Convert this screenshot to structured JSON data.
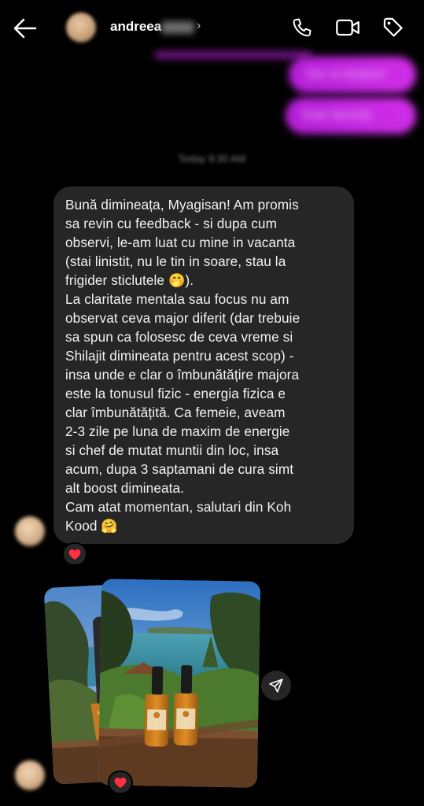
{
  "header": {
    "back_icon": "arrow-left-icon",
    "name": "andreea",
    "chevron": "›",
    "icons": [
      "phone-icon",
      "video-camera-icon",
      "tag-icon"
    ]
  },
  "outgoing": [
    {
      "text": "Dar ai drepturi"
    },
    {
      "text": "Este favorite"
    }
  ],
  "timestamp": "Today 9:30 AM",
  "incoming_message": {
    "text": "Bună dimineața, Myagisan! Am promis\nsa revin cu feedback - si dupa cum\nobservi, le-am luat cu mine in vacanta\n(stai linistit, nu le tin in soare, stau la\nfrigider sticlutele 🤭).\nLa claritate mentala sau focus nu am\nobservat ceva major diferit (dar trebuie\nsa spun ca folosesc de ceva vreme si\nShilajit dimineata pentru acest scop) -\ninsa unde e clar o îmbunătățire majora\neste la tonusul fizic - energia fizica e\nclar îmbunătățită. Ca femeie, aveam\n2-3 zile pe luna de maxim de energie\nsi chef de mutat muntii din loc, insa\nacum, dupa 3 saptamani de cura simt\nalt boost dimineata.\nCam atat momentan, salutari din Koh\nKood 🤗",
    "reaction": "heart-icon"
  },
  "photo_message": {
    "reaction": "heart-icon",
    "share_icon": "send-icon"
  },
  "colors": {
    "background": "#000000",
    "incoming_bubble": "#262626",
    "outgoing_bubble": "#c026e0",
    "reaction_heart": "#ff3040"
  }
}
